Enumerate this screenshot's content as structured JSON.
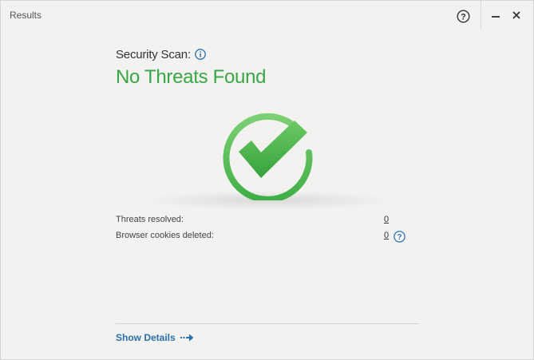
{
  "window": {
    "title": "Results"
  },
  "scan": {
    "label": "Security Scan:",
    "result": "No Threats Found",
    "result_color": "#3aa646"
  },
  "stats": [
    {
      "label": "Threats resolved:",
      "value": "0"
    },
    {
      "label": "Browser cookies deleted:",
      "value": "0"
    }
  ],
  "footer": {
    "details_label": "Show Details"
  },
  "icons": {
    "help": "help-circle-icon",
    "info": "info-icon",
    "minimize": "minimize-icon",
    "close": "close-icon",
    "check": "checkmark-icon",
    "arrow": "arrow-right-icon"
  },
  "colors": {
    "accent_blue": "#2a6fb0",
    "success_green": "#3aa646"
  }
}
